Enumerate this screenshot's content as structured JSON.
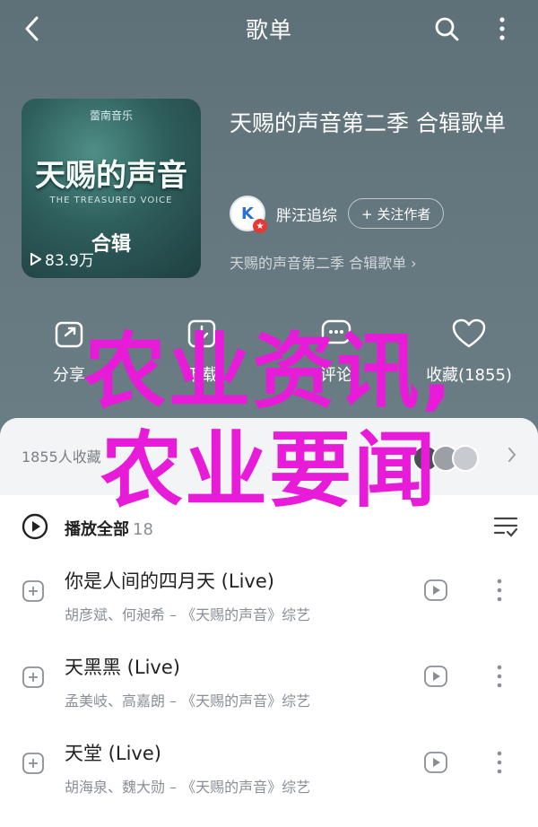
{
  "header": {
    "title": "歌单"
  },
  "playlist": {
    "cover_top": "蕾南音乐",
    "cover_main": "天赐的声音",
    "cover_subtitle": "THE TREASURED VOICE",
    "cover_tag": "合辑",
    "play_count": "83.9万",
    "title": "天赐的声音第二季 合辑歌单",
    "creator_initial": "K",
    "creator_name": "胖汪追综",
    "follow_label": "+ 关注作者",
    "description": "天赐的声音第二季 合辑歌单 ›"
  },
  "actions": {
    "share_label": "分享",
    "download_label": "下载",
    "comment_label": "评论",
    "favorite_label": "收藏(1855)"
  },
  "favorites": {
    "text": "1855人收藏"
  },
  "play_all": {
    "label": "播放全部",
    "count": "18"
  },
  "songs": [
    {
      "title": "你是人间的四月天 (Live)",
      "artist": "胡彦斌、何昶希 – 《天赐的声音》综艺"
    },
    {
      "title": "天黑黑 (Live)",
      "artist": "孟美岐、高嘉朗 – 《天赐的声音》综艺"
    },
    {
      "title": "天堂 (Live)",
      "artist": "胡海泉、魏大勋 – 《天赐的声音》综艺"
    }
  ],
  "watermark": {
    "line1": "农业资讯,",
    "line2": "农业要闻"
  },
  "colors": {
    "header_bg": "#65777f",
    "watermark": "#e81bd9",
    "accent_blue": "#2a6fdb"
  }
}
